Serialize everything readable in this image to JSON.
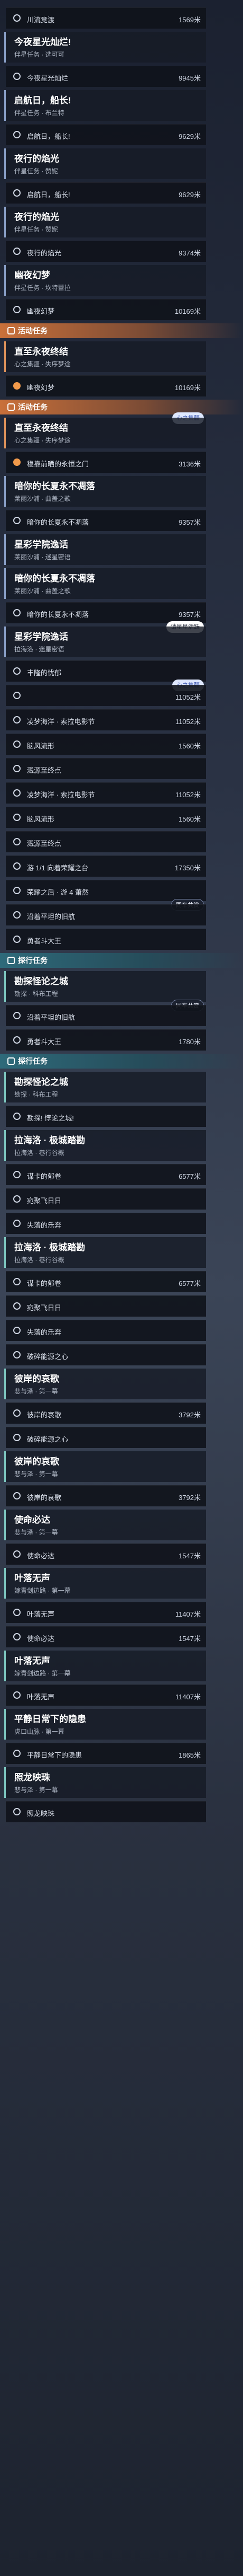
{
  "colors": {
    "accent_event": "#e0935b",
    "accent_trail": "#7dc7c0",
    "marker_orange": "#f19a4b"
  },
  "icons": {
    "row_marker": "circle-marker-icon",
    "section": "quest-book-icon"
  },
  "unit": "米",
  "items": [
    {
      "type": "row",
      "label": "川流竞渡",
      "dist": "1569米",
      "marker": "white"
    },
    {
      "type": "card",
      "kind": "daily",
      "name": "今夜星光灿烂!",
      "sub": "伴星任务 · 选可可"
    },
    {
      "type": "row",
      "label": "今夜星光灿烂",
      "dist": "9945米",
      "marker": "white"
    },
    {
      "type": "card",
      "kind": "daily",
      "name": "启航日，船长!",
      "sub": "伴星任务 · 布兰特"
    },
    {
      "type": "row",
      "label": "启航日，船长!",
      "dist": "9629米",
      "marker": "white"
    },
    {
      "type": "card",
      "kind": "daily",
      "name": "夜行的焰光",
      "sub": "伴星任务 · 赞妮"
    },
    {
      "type": "row",
      "label": "启航日，船长!",
      "dist": "9629米",
      "marker": "white"
    },
    {
      "type": "card",
      "kind": "daily",
      "name": "夜行的焰光",
      "sub": "伴星任务 · 赞妮"
    },
    {
      "type": "row",
      "label": "夜行的焰光",
      "dist": "9374米",
      "marker": "white"
    },
    {
      "type": "card",
      "kind": "daily",
      "name": "幽夜幻梦",
      "sub": "伴星任务 · 坎特蕾拉"
    },
    {
      "type": "row",
      "label": "幽夜幻梦",
      "dist": "10169米",
      "marker": "white"
    },
    {
      "type": "section",
      "kind": "event",
      "label": "活动任务"
    },
    {
      "type": "card",
      "kind": "event",
      "name": "直至永夜终结",
      "sub": "心之集疆 · 失序梦途"
    },
    {
      "type": "row",
      "label": "幽夜幻梦",
      "dist": "10169米",
      "marker": "orange"
    },
    {
      "type": "section",
      "kind": "event",
      "label": "活动任务"
    },
    {
      "type": "card",
      "kind": "event",
      "name": "直至永夜终结",
      "sub": "心之集疆 · 失序梦途",
      "badge": {
        "text": "心之集疆",
        "style": "blue"
      }
    },
    {
      "type": "row",
      "label": "稳靠前晒的永恒之门",
      "dist": "3136米",
      "marker": "orange"
    },
    {
      "type": "card",
      "kind": "daily",
      "name": "暗你的长夏永不凋落",
      "sub": "莱丽沙浦 · 曲盖之歌"
    },
    {
      "type": "row",
      "label": "暗你的长夏永不凋落",
      "dist": "9357米",
      "marker": "white"
    },
    {
      "type": "card",
      "kind": "daily",
      "name": "星彩学院逸话",
      "sub": "莱丽沙浦 · 迷星密语"
    },
    {
      "type": "card",
      "kind": "daily",
      "name": "暗你的长夏永不凋落",
      "sub": "莱丽沙浦 · 曲盖之歌"
    },
    {
      "type": "row",
      "label": "暗你的长夏永不凋落",
      "dist": "9357米",
      "marker": "white"
    },
    {
      "type": "card",
      "kind": "daily",
      "name": "星彩学院逸话",
      "sub": "拉海洛 · 迷星密语",
      "badge": {
        "text": "请星星活跃",
        "style": "white"
      }
    },
    {
      "type": "row",
      "label": "丰隆的忧郁",
      "dist": "",
      "marker": "white"
    },
    {
      "type": "row",
      "label": "",
      "dist": "11052米",
      "marker": "white",
      "badge": {
        "text": "心之集疆",
        "style": "blue"
      }
    },
    {
      "type": "row",
      "label": "凌梦海洋 · 索拉电影节",
      "dist": "11052米",
      "marker": "white"
    },
    {
      "type": "row",
      "label": "脑风流形",
      "dist": "1560米",
      "marker": "white"
    },
    {
      "type": "row",
      "label": "溅源至终点",
      "dist": "",
      "marker": "white"
    },
    {
      "type": "row",
      "label": "凌梦海洋 · 索拉电影节",
      "dist": "11052米",
      "marker": "white"
    },
    {
      "type": "row",
      "label": "脑风流形",
      "dist": "1560米",
      "marker": "white"
    },
    {
      "type": "row",
      "label": "溅源至终点",
      "dist": "",
      "marker": "white"
    },
    {
      "type": "row",
      "label": "游 1/1 向着荣耀之台",
      "dist": "17350米",
      "marker": "white"
    },
    {
      "type": "row",
      "label": "荣耀之后 · 游 4 萧然",
      "dist": "",
      "marker": "white"
    },
    {
      "type": "row",
      "label": "沿着平坦的旧航",
      "dist": "",
      "marker": "white",
      "badge": {
        "text": "同车共赏",
        "style": "dark"
      }
    },
    {
      "type": "row",
      "label": "勇者斗大王",
      "dist": "",
      "marker": "white"
    },
    {
      "type": "section",
      "kind": "trail",
      "label": "探行任务"
    },
    {
      "type": "card",
      "kind": "trail",
      "name": "勘探怪论之城",
      "sub": "勘探 · 科布工程"
    },
    {
      "type": "row",
      "label": "沿着平坦的旧航",
      "dist": "",
      "marker": "white",
      "badge": {
        "text": "同车共赏",
        "style": "dark"
      }
    },
    {
      "type": "row",
      "label": "勇者斗大王",
      "dist": "1780米",
      "marker": "white"
    },
    {
      "type": "section",
      "kind": "trail",
      "label": "探行任务"
    },
    {
      "type": "card",
      "kind": "trail",
      "name": "勘探怪论之城",
      "sub": "勘探 · 科布工程"
    },
    {
      "type": "row",
      "label": "勘探! 悖论之城!",
      "dist": "",
      "marker": "white"
    },
    {
      "type": "card",
      "kind": "trail",
      "name": "拉海洛 · 极城踏勘",
      "sub": "拉海洛 · 巷行谷概"
    },
    {
      "type": "row",
      "label": "谋卡的郁卷",
      "dist": "6577米",
      "marker": "white"
    },
    {
      "type": "row",
      "label": "宛聚飞日日",
      "dist": "",
      "marker": "white"
    },
    {
      "type": "row",
      "label": "失落的乐奔",
      "dist": "",
      "marker": "white"
    },
    {
      "type": "card",
      "kind": "trail",
      "name": "拉海洛 · 极城踏勘",
      "sub": "拉海洛 · 巷行谷概"
    },
    {
      "type": "row",
      "label": "谋卡的郁卷",
      "dist": "6577米",
      "marker": "white"
    },
    {
      "type": "row",
      "label": "宛聚飞日日",
      "dist": "",
      "marker": "white"
    },
    {
      "type": "row",
      "label": "失落的乐奔",
      "dist": "",
      "marker": "white"
    },
    {
      "type": "row",
      "label": "破碎能源之心",
      "dist": "",
      "marker": "white"
    },
    {
      "type": "card",
      "kind": "trail",
      "name": "彼岸的哀歌",
      "sub": "悲与泽 · 第一幕"
    },
    {
      "type": "row",
      "label": "彼岸的哀歌",
      "dist": "3792米",
      "marker": "white"
    },
    {
      "type": "row",
      "label": "破碎能源之心",
      "dist": "",
      "marker": "white"
    },
    {
      "type": "card",
      "kind": "trail",
      "name": "彼岸的哀歌",
      "sub": "悲与泽 · 第一幕"
    },
    {
      "type": "row",
      "label": "彼岸的哀歌",
      "dist": "3792米",
      "marker": "white"
    },
    {
      "type": "card",
      "kind": "trail",
      "name": "使命必达",
      "sub": "悲与泽 · 第一幕"
    },
    {
      "type": "row",
      "label": "使命必达",
      "dist": "1547米",
      "marker": "white"
    },
    {
      "type": "card",
      "kind": "trail",
      "name": "叶落无声",
      "sub": "嫁青剑边路 · 第一幕"
    },
    {
      "type": "row",
      "label": "叶落无声",
      "dist": "11407米",
      "marker": "white"
    },
    {
      "type": "row",
      "label": "使命必达",
      "dist": "1547米",
      "marker": "white"
    },
    {
      "type": "card",
      "kind": "trail",
      "name": "叶落无声",
      "sub": "嫁青剑边路 · 第一幕"
    },
    {
      "type": "row",
      "label": "叶落无声",
      "dist": "11407米",
      "marker": "white"
    },
    {
      "type": "card",
      "kind": "trail",
      "name": "平静日常下的隐患",
      "sub": "虎口山脉 · 第一幕"
    },
    {
      "type": "row",
      "label": "平静日常下的隐患",
      "dist": "1865米",
      "marker": "white"
    },
    {
      "type": "card",
      "kind": "trail",
      "name": "照龙映珠",
      "sub": "悲与泽 · 第一幕"
    },
    {
      "type": "row",
      "label": "照龙映珠",
      "dist": "",
      "marker": "white"
    }
  ]
}
